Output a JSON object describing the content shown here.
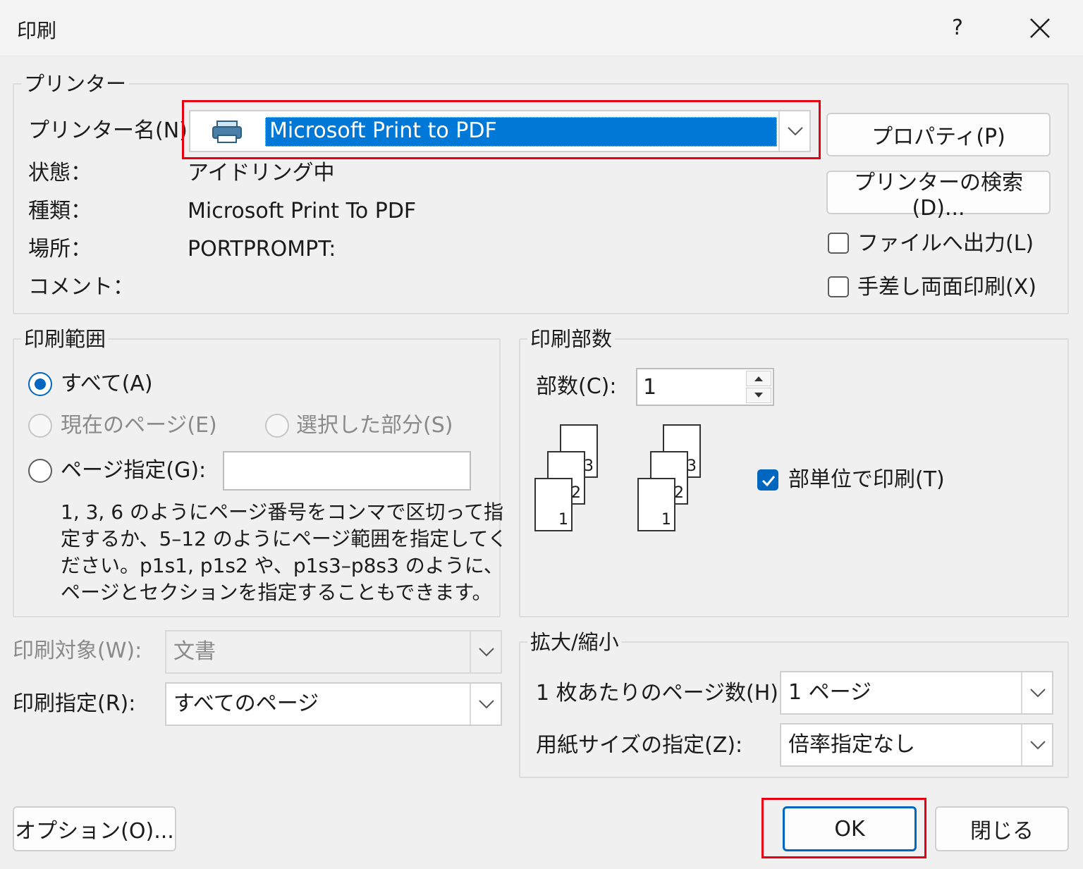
{
  "window": {
    "title": "印刷",
    "help_label": "?"
  },
  "printer": {
    "group_label": "プリンター",
    "name_label": "プリンター名(N):",
    "name_value": "Microsoft Print to PDF",
    "properties_button": "プロパティ(P)",
    "find_printer_button": "プリンターの検索(D)...",
    "status_label": "状態：",
    "status_value": "アイドリング中",
    "type_label": "種類：",
    "type_value": "Microsoft Print To PDF",
    "where_label": "場所：",
    "where_value": "PORTPROMPT:",
    "comment_label": "コメント：",
    "print_to_file": {
      "label": "ファイルへ出力(L)",
      "checked": false
    },
    "manual_duplex": {
      "label": "手差し両面印刷(X)",
      "checked": false
    }
  },
  "page_range": {
    "group_label": "印刷範囲",
    "all": {
      "label": "すべて(A)",
      "selected": true
    },
    "current_page": {
      "label": "現在のページ(E)",
      "enabled": false
    },
    "selection": {
      "label": "選択した部分(S)",
      "enabled": false
    },
    "pages": {
      "label": "ページ指定(G):",
      "value": ""
    },
    "help_lines": [
      "1, 3, 6 のようにページ番号をコンマで区切って指",
      "定するか、5–12 のようにページ範囲を指定してく",
      "ださい。p1s1, p1s2 や、p1s3–p8s3 のように、",
      "ページとセクションを指定することもできます。"
    ]
  },
  "copies": {
    "group_label": "印刷部数",
    "count_label": "部数(C):",
    "count_value": "1",
    "collate": {
      "label": "部単位で印刷(T)",
      "checked": true
    },
    "page_numbers": [
      "3",
      "2",
      "1"
    ]
  },
  "print_what": {
    "label": "印刷対象(W):",
    "value": "文書"
  },
  "print_option": {
    "label": "印刷指定(R):",
    "value": "すべてのページ"
  },
  "zoom": {
    "group_label": "拡大/縮小",
    "pages_per_sheet_label": "1 枚あたりのページ数(H):",
    "pages_per_sheet_value": "1 ページ",
    "scale_label": "用紙サイズの指定(Z):",
    "scale_value": "倍率指定なし"
  },
  "footer": {
    "options_button": "オプション(O)...",
    "ok_button": "OK",
    "close_button": "閉じる"
  },
  "colors": {
    "accent": "#0067c0",
    "highlight": "#e60012",
    "selection": "#0078d7"
  }
}
